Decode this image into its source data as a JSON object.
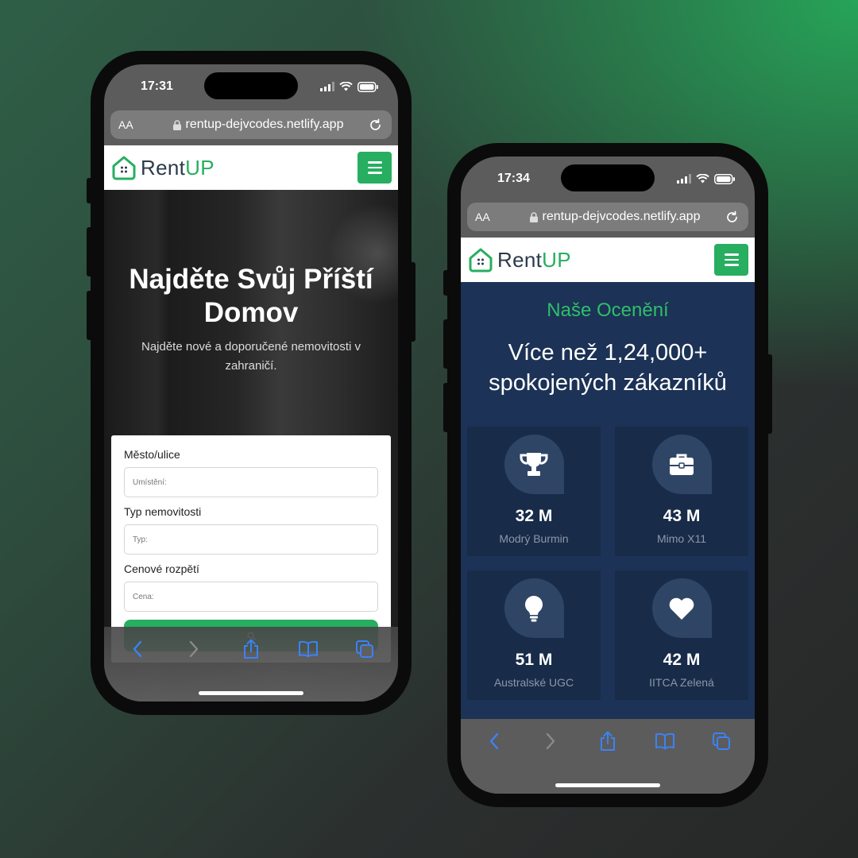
{
  "colors": {
    "accent": "#27ae60",
    "awards_bg": "#1c3256",
    "card_bg": "#182b49"
  },
  "phone_left": {
    "status": {
      "time": "17:31"
    },
    "browser": {
      "aa": "AA",
      "url": "rentup-dejvcodes.netlify.app"
    },
    "logo": {
      "name": "Rent",
      "accent": "UP"
    },
    "hero": {
      "title": "Najděte Svůj Příští Domov",
      "subtitle": "Najděte nové a doporučené nemovitosti v zahraničí."
    },
    "form": {
      "city_label": "Město/ulice",
      "city_placeholder": "Umístění:",
      "type_label": "Typ nemovitosti",
      "type_placeholder": "Typ:",
      "price_label": "Cenové rozpětí",
      "price_placeholder": "Cena:"
    }
  },
  "phone_right": {
    "status": {
      "time": "17:34"
    },
    "browser": {
      "aa": "AA",
      "url": "rentup-dejvcodes.netlify.app"
    },
    "logo": {
      "name": "Rent",
      "accent": "UP"
    },
    "awards": {
      "kicker": "Naše Ocenění",
      "title": "Více než 1,24,000+ spokojených zákazníků",
      "items": [
        {
          "icon": "trophy-icon",
          "value": "32 M",
          "caption": "Modrý Burmin"
        },
        {
          "icon": "briefcase-icon",
          "value": "43 M",
          "caption": "Mimo X11"
        },
        {
          "icon": "lightbulb-icon",
          "value": "51 M",
          "caption": "Australské UGC"
        },
        {
          "icon": "heart-icon",
          "value": "42 M",
          "caption": "IITCA Zelená"
        }
      ]
    }
  }
}
